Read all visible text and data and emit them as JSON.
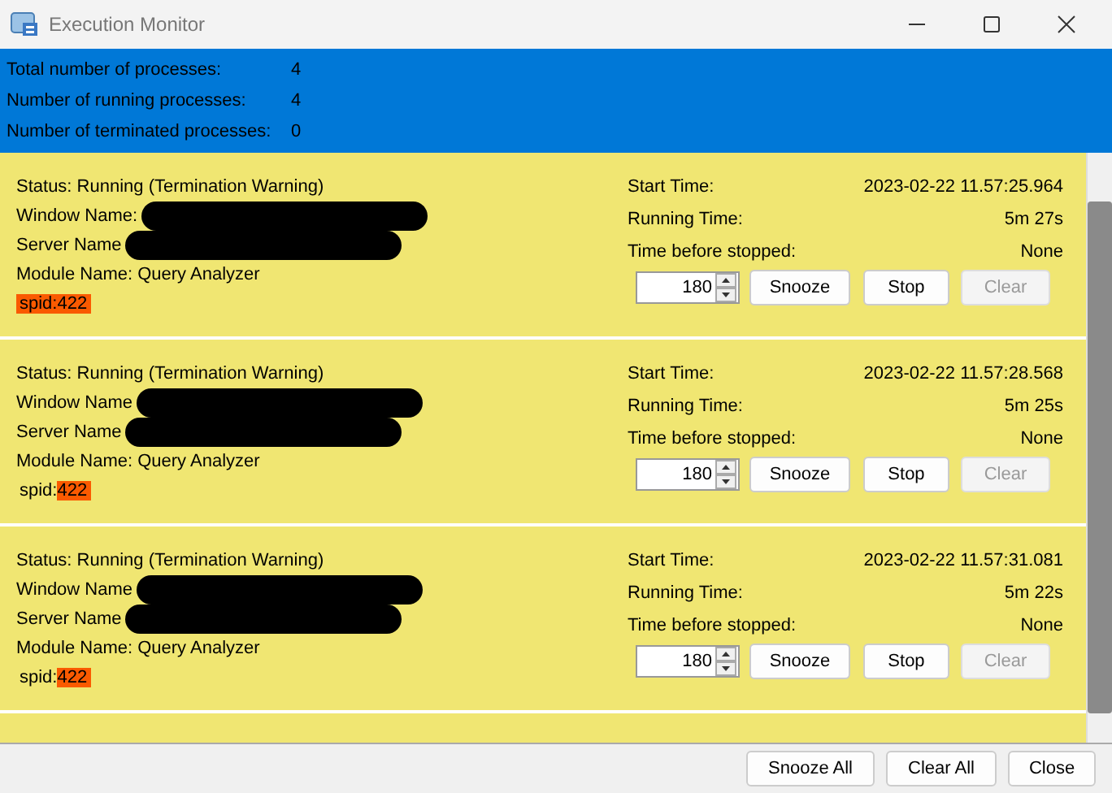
{
  "window": {
    "title": "Execution Monitor"
  },
  "summary": [
    {
      "label": "Total number of processes:",
      "value": "4"
    },
    {
      "label": "Number of running processes:",
      "value": "4"
    },
    {
      "label": "Number of terminated processes:",
      "value": "0"
    }
  ],
  "processes": [
    {
      "status": "Status: Running (Termination Warning)",
      "window_label": "Window Name:",
      "server_label": "Server Name",
      "module": "Module Name: Query Analyzer",
      "spid_label": "spid:",
      "spid_value": "422",
      "label_highlighted": true,
      "value_highlighted": true,
      "start_label": "Start Time:",
      "start_value": "2023-02-22 11.57:25.964",
      "running_label": "Running Time:",
      "running_value": "5m 27s",
      "stopped_label": "Time before stopped:",
      "stopped_value": "None",
      "snooze_value": "180",
      "buttons": [
        {
          "label": "Snooze",
          "disabled": false
        },
        {
          "label": "Stop",
          "disabled": false
        },
        {
          "label": "Clear",
          "disabled": true
        }
      ]
    },
    {
      "status": "Status: Running (Termination Warning)",
      "window_label": "Window Name",
      "server_label": "Server Name",
      "module": "Module Name: Query Analyzer",
      "spid_label": "spid:",
      "spid_value": "422",
      "label_highlighted": false,
      "value_highlighted": true,
      "start_label": "Start Time:",
      "start_value": "2023-02-22 11.57:28.568",
      "running_label": "Running Time:",
      "running_value": "5m 25s",
      "stopped_label": "Time before stopped:",
      "stopped_value": "None",
      "snooze_value": "180",
      "buttons": [
        {
          "label": "Snooze",
          "disabled": false
        },
        {
          "label": "Stop",
          "disabled": false
        },
        {
          "label": "Clear",
          "disabled": true
        }
      ]
    },
    {
      "status": "Status: Running (Termination Warning)",
      "window_label": "Window Name",
      "server_label": "Server Name",
      "module": "Module Name: Query Analyzer",
      "spid_label": "spid:",
      "spid_value": "422",
      "label_highlighted": false,
      "value_highlighted": true,
      "start_label": "Start Time:",
      "start_value": "2023-02-22 11.57:31.081",
      "running_label": "Running Time:",
      "running_value": "5m 22s",
      "stopped_label": "Time before stopped:",
      "stopped_value": "None",
      "snooze_value": "180",
      "buttons": [
        {
          "label": "Snooze",
          "disabled": false
        },
        {
          "label": "Stop",
          "disabled": false
        },
        {
          "label": "Clear",
          "disabled": true
        }
      ]
    }
  ],
  "footer_buttons": [
    "Snooze All",
    "Clear All",
    "Close"
  ]
}
